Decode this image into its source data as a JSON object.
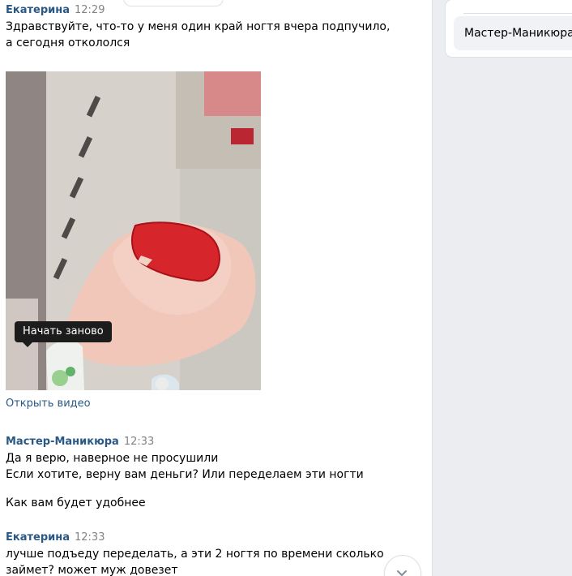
{
  "top_tab": {
    "label": ""
  },
  "messages": [
    {
      "sender": "Екатерина",
      "time": "12:29",
      "lines": [
        "Здравствуйте, что-то у меня один край ногтя вчера подпучило,",
        "а сегодня откололся"
      ]
    },
    {
      "sender": "Мастер-Маникюра",
      "time": "12:33",
      "lines": [
        "Да я верю, наверное не просушили",
        "Если хотите, верну вам деньги? Или переделаем эти ногти",
        "Как вам будет удобнее"
      ]
    },
    {
      "sender": "Екатерина",
      "time": "12:33",
      "lines": [
        "лучше подъеду переделать, а эти 2 ногтя по времени сколько",
        "займет? может муж довезет"
      ]
    }
  ],
  "video": {
    "tooltip": "Начать заново",
    "open_link": "Открыть видео"
  },
  "right_panel": {
    "chip": "Мастер-Маникюра"
  },
  "colors": {
    "sender": "#2a5885",
    "time": "#828282",
    "right_panel_bg": "#ebedf0",
    "nail": "#d7262b",
    "tooltip_bg": "#1c1c1c"
  },
  "icons": {
    "scroll_down": "chevron-down-icon"
  }
}
